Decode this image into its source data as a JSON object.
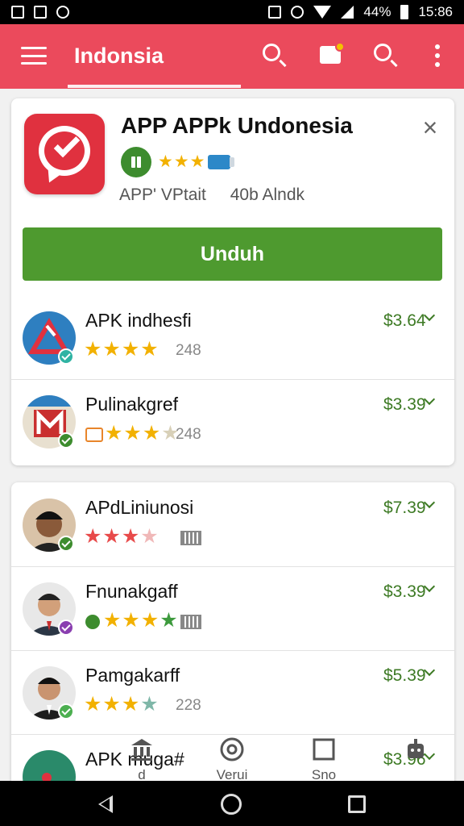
{
  "status_bar": {
    "battery": "44%",
    "time": "15:86"
  },
  "app_bar": {
    "title": "Indonsia"
  },
  "featured": {
    "title": "APP APPk Undonesia",
    "stars": "★★★",
    "meta_left": "APP' VPtait",
    "meta_right": "40b Alndk",
    "download_label": "Unduh"
  },
  "list_card_1": [
    {
      "name": "APK indhesfi",
      "stars_filled": "★★★★",
      "stars_empty": "",
      "rating_count": "248",
      "price": "$3.64",
      "avatar_color": "#2e7fc0",
      "verify_color": "#2fb3a3"
    },
    {
      "name": "Pulinakgref",
      "stars_filled": "★★★",
      "stars_empty": "★",
      "rating_count": "248",
      "price": "$3.39",
      "avatar_color": "#c92f2f",
      "verify_color": "#3d8c2e"
    }
  ],
  "list_card_2": [
    {
      "name": "APdLiniunosi",
      "stars_filled": "★★★",
      "stars_empty": "★",
      "rating_count": "",
      "price": "$7.39",
      "avatar_color": "#6b4a3a",
      "verify_color": "#3d8c2e"
    },
    {
      "name": "Fnunakgaff",
      "stars_filled": "★★★",
      "stars_empty": "",
      "rating_count": "",
      "price": "$3.39",
      "avatar_color": "#3a3a3a",
      "verify_color": "#8a3fb0"
    },
    {
      "name": "Pamgakarff",
      "stars_filled": "★★★",
      "stars_empty": "★",
      "rating_count": "228",
      "price": "$5.39",
      "avatar_color": "#2b2b2b",
      "verify_color": "#4caf50"
    },
    {
      "name": "APK muga#",
      "stars_filled": "",
      "stars_empty": "",
      "rating_count": "",
      "price": "$3.96",
      "avatar_color": "#2a8a6a",
      "verify_color": "#4caf50"
    }
  ],
  "tabs": [
    {
      "label": "d"
    },
    {
      "label": "Verui"
    },
    {
      "label": "Sno"
    },
    {
      "label": ""
    }
  ],
  "colors": {
    "accent": "#eb4a5c",
    "download": "#4e9a2f",
    "price": "#3d7a24",
    "star": "#f2b100"
  }
}
